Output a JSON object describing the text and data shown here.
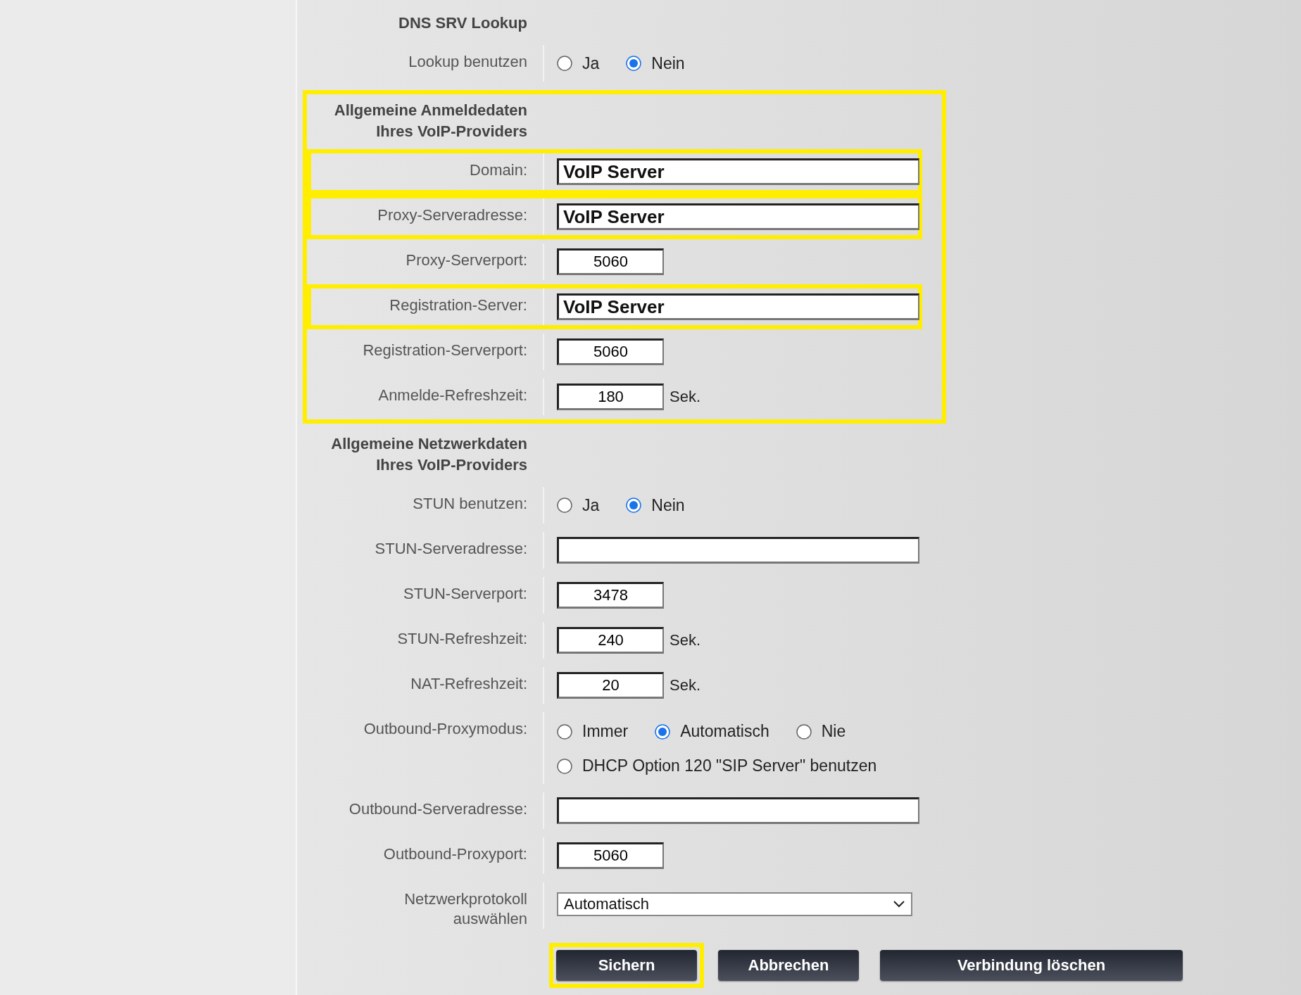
{
  "sections": [
    {
      "title_lines": [
        "DNS SRV Lookup"
      ],
      "highlighted": false,
      "rows": [
        {
          "kind": "radio",
          "label": "Lookup benutzen",
          "option_lines": [
            [
              {
                "label": "Ja",
                "selected": false
              },
              {
                "label": "Nein",
                "selected": true
              }
            ]
          ],
          "highlighted": false
        }
      ]
    },
    {
      "title_lines": [
        "Allgemeine Anmeldedaten",
        "Ihres VoIP-Providers"
      ],
      "highlighted": true,
      "rows": [
        {
          "kind": "wide",
          "label": "Domain:",
          "value": "VoIP Server",
          "highlighted": true
        },
        {
          "kind": "wide",
          "label": "Proxy-Serveradresse:",
          "value": "VoIP Server",
          "highlighted": true
        },
        {
          "kind": "short",
          "label": "Proxy-Serverport:",
          "value": "5060",
          "highlighted": false
        },
        {
          "kind": "wide",
          "label": "Registration-Server:",
          "value": "VoIP Server",
          "highlighted": true
        },
        {
          "kind": "short",
          "label": "Registration-Serverport:",
          "value": "5060",
          "highlighted": false
        },
        {
          "kind": "short",
          "label": "Anmelde-Refreshzeit:",
          "value": "180",
          "unit": "Sek.",
          "highlighted": false
        }
      ]
    },
    {
      "title_lines": [
        "Allgemeine Netzwerkdaten",
        "Ihres VoIP-Providers"
      ],
      "highlighted": false,
      "rows": [
        {
          "kind": "radio",
          "label": "STUN benutzen:",
          "option_lines": [
            [
              {
                "label": "Ja",
                "selected": false
              },
              {
                "label": "Nein",
                "selected": true
              }
            ]
          ],
          "highlighted": false
        },
        {
          "kind": "wide",
          "label": "STUN-Serveradresse:",
          "highlighted": false
        },
        {
          "kind": "short",
          "label": "STUN-Serverport:",
          "value": "3478",
          "highlighted": false
        },
        {
          "kind": "short",
          "label": "STUN-Refreshzeit:",
          "value": "240",
          "unit": "Sek.",
          "highlighted": false
        },
        {
          "kind": "short",
          "label": "NAT-Refreshzeit:",
          "value": "20",
          "unit": "Sek.",
          "highlighted": false
        },
        {
          "kind": "radio",
          "label": "Outbound-Proxymodus:",
          "option_lines": [
            [
              {
                "label": "Immer",
                "selected": false
              },
              {
                "label": "Automatisch",
                "selected": true
              },
              {
                "label": "Nie",
                "selected": false
              }
            ],
            [
              {
                "label": "DHCP Option 120 \"SIP Server\" benutzen",
                "selected": false
              }
            ]
          ],
          "highlighted": false
        },
        {
          "kind": "wide",
          "label": "Outbound-Serveradresse:",
          "highlighted": false
        },
        {
          "kind": "short",
          "label": "Outbound-Proxyport:",
          "value": "5060",
          "highlighted": false
        },
        {
          "kind": "select",
          "label_lines": [
            "Netzwerkprotokoll",
            "auswählen"
          ],
          "value": "Automatisch",
          "highlighted": false
        }
      ]
    }
  ],
  "buttons": [
    {
      "label": "Sichern",
      "highlighted": true
    },
    {
      "label": "Abbrechen",
      "highlighted": false
    },
    {
      "label": "Verbindung löschen",
      "highlighted": false
    }
  ]
}
